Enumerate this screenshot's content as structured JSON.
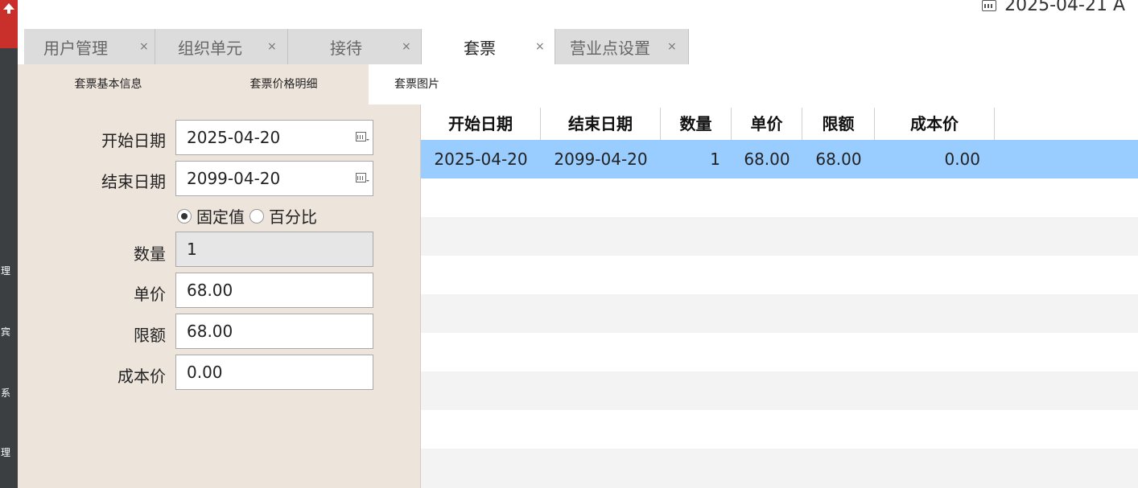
{
  "header": {
    "date": "2025-04-21 A"
  },
  "sidebar": {
    "labels": [
      "理",
      "宾",
      "系",
      "理"
    ]
  },
  "tabs": [
    {
      "label": "用户管理",
      "close": "×",
      "active": false
    },
    {
      "label": "组织单元",
      "close": "×",
      "active": false
    },
    {
      "label": "接待",
      "close": "×",
      "active": false
    },
    {
      "label": "套票",
      "close": "×",
      "active": true
    },
    {
      "label": "营业点设置",
      "close": "×",
      "active": false
    }
  ],
  "subtabs": [
    {
      "label": "套票基本信息"
    },
    {
      "label": "套票价格明细"
    },
    {
      "label": "套票图片"
    }
  ],
  "form": {
    "start_date_label": "开始日期",
    "start_date_value": "2025-04-20",
    "end_date_label": "结束日期",
    "end_date_value": "2099-04-20",
    "radio_fixed": "固定值",
    "radio_percent": "百分比",
    "quantity_label": "数量",
    "quantity_value": "1",
    "unit_price_label": "单价",
    "unit_price_value": "68.00",
    "limit_label": "限额",
    "limit_value": "68.00",
    "cost_label": "成本价",
    "cost_value": "0.00"
  },
  "table": {
    "columns": [
      "开始日期",
      "结束日期",
      "数量",
      "单价",
      "限额",
      "成本价"
    ],
    "rows": [
      [
        "2025-04-20",
        "2099-04-20",
        "1",
        "68.00",
        "68.00",
        "0.00"
      ]
    ]
  }
}
